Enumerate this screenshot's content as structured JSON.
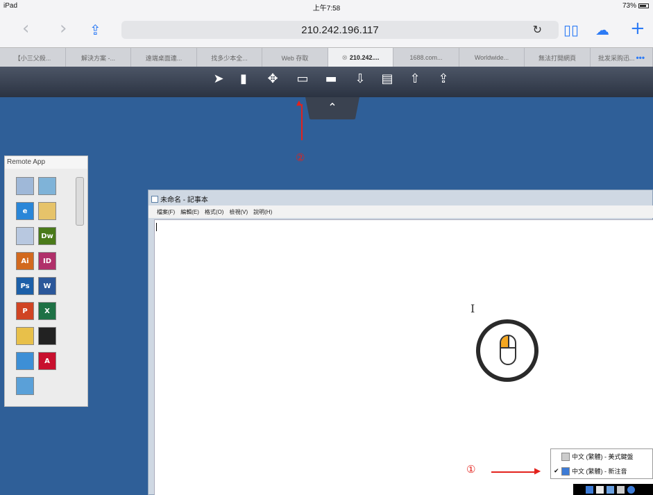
{
  "status_bar": {
    "device": "iPad ",
    "time": "上午7:58",
    "battery": "73%"
  },
  "browser": {
    "url": "210.242.196.117",
    "icons": [
      "back-icon",
      "forward-icon",
      "share-icon",
      "reload-icon",
      "reader-icon",
      "cloud-icon",
      "add-tab-icon"
    ]
  },
  "tabs": [
    {
      "label": "【小三父殺..."
    },
    {
      "label": "解決方案 -..."
    },
    {
      "label": "遠端桌面連..."
    },
    {
      "label": "找多少本全..."
    },
    {
      "label": "Web 存取"
    },
    {
      "label": "210.242....",
      "active": true
    },
    {
      "label": "1688.com..."
    },
    {
      "label": "Worldwide..."
    },
    {
      "label": "無法打開網頁"
    },
    {
      "label": "批发采购迅..."
    }
  ],
  "remote_toolbar": {
    "icons": [
      "pointer-icon",
      "mouse-icon",
      "move-icon",
      "keyboard-icon",
      "print-icon",
      "download-icon",
      "clipboard-icon",
      "upload-icon",
      "export-icon"
    ]
  },
  "annotations": {
    "circle_1": "①",
    "circle_2": "②"
  },
  "remote_app": {
    "title": "Remote App",
    "apps": [
      {
        "name": "calculator-icon",
        "label": "",
        "color": "#9fb8d8"
      },
      {
        "name": "eraser-icon",
        "label": "",
        "color": "#7fb3d8"
      },
      {
        "name": "ie-icon",
        "label": "e",
        "color": "#2a86d8"
      },
      {
        "name": "paint-icon",
        "label": "",
        "color": "#e6c36a"
      },
      {
        "name": "image-viewer-icon",
        "label": "",
        "color": "#b8c8e0"
      },
      {
        "name": "dreamweaver-icon",
        "label": "Dw",
        "color": "#4a7a1a"
      },
      {
        "name": "illustrator-icon",
        "label": "Ai",
        "color": "#d2691e"
      },
      {
        "name": "indesign-icon",
        "label": "ID",
        "color": "#b0306a"
      },
      {
        "name": "photoshop-icon",
        "label": "Ps",
        "color": "#1c5fa8"
      },
      {
        "name": "word-icon",
        "label": "W",
        "color": "#2b579a"
      },
      {
        "name": "powerpoint-icon",
        "label": "P",
        "color": "#d04423"
      },
      {
        "name": "excel-icon",
        "label": "X",
        "color": "#1e7145"
      },
      {
        "name": "gallery-icon",
        "label": "",
        "color": "#e8c04a"
      },
      {
        "name": "qq-icon",
        "label": "",
        "color": "#222222"
      },
      {
        "name": "remote-desktop-icon",
        "label": "",
        "color": "#3d8fd6"
      },
      {
        "name": "acrobat-icon",
        "label": "A",
        "color": "#c8102e"
      },
      {
        "name": "window-icon",
        "label": "",
        "color": "#5aa0d8"
      }
    ]
  },
  "notepad": {
    "title": "未命名 - 記事本",
    "menu": [
      "檔案(F)",
      "編輯(E)",
      "格式(O)",
      "檢視(V)",
      "說明(H)"
    ]
  },
  "ime": {
    "items": [
      {
        "label": "中文 (繁體) - 美式鍵盤",
        "checked": false
      },
      {
        "label": "中文 (繁體) - 新注音",
        "checked": true
      }
    ]
  },
  "colors": {
    "desktop": "#2f5f98",
    "accent": "#2d7bf5",
    "annotation": "#e3221c"
  }
}
